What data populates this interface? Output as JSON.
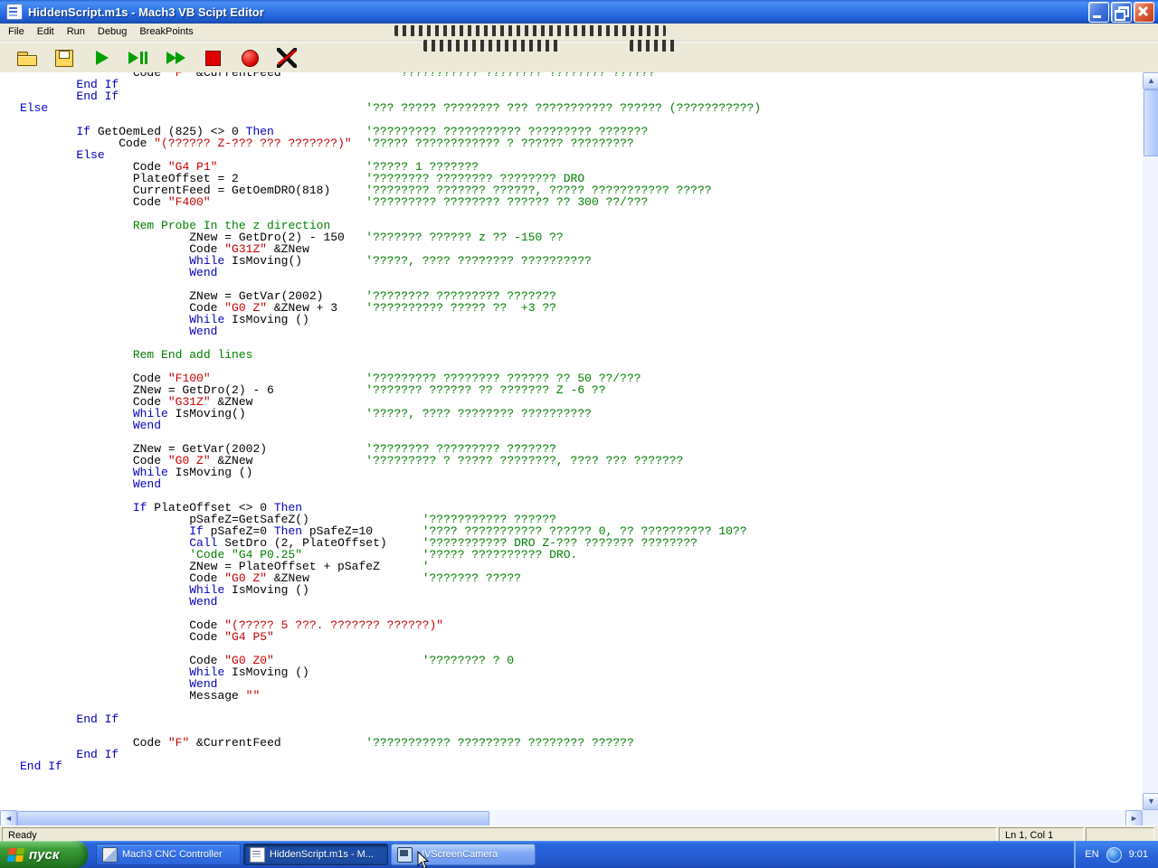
{
  "window": {
    "title": "HiddenScript.m1s - Mach3 VB Scipt Editor"
  },
  "menu": {
    "items": [
      "File",
      "Edit",
      "Run",
      "Debug",
      "BreakPoints"
    ]
  },
  "toolbar": {
    "buttons": [
      {
        "id": "open"
      },
      {
        "id": "save"
      },
      {
        "id": "run"
      },
      {
        "id": "step"
      },
      {
        "id": "fast-forward"
      },
      {
        "id": "stop"
      },
      {
        "id": "breakpoint"
      },
      {
        "id": "clear-breakpoints"
      }
    ]
  },
  "scrollbar": {
    "up": "▲",
    "down": "▼",
    "left": "◄",
    "right": "►"
  },
  "statusbar": {
    "ready": "Ready",
    "position": "Ln 1, Col 1"
  },
  "taskbar": {
    "start_label": "пуск",
    "buttons": [
      {
        "id": "mach3",
        "label": "Mach3 CNC Controller",
        "state": "normal"
      },
      {
        "id": "hiddenscript",
        "label": "HiddenScript.m1s - M...",
        "state": "active"
      },
      {
        "id": "uvscreencamera",
        "label": "UVScreenCamera",
        "state": "highlight"
      }
    ],
    "tray": {
      "language": "EN",
      "time": "9:01"
    }
  },
  "colors": {
    "keyword": "#0000C0",
    "string": "#C80000",
    "comment": "#008000",
    "normal": "#000000"
  },
  "editor": {
    "lines": [
      {
        "i": 16,
        "s": [
          [
            "n",
            "Code "
          ],
          [
            "s",
            "\"F\""
          ],
          [
            "n",
            " &CurrentFeed"
          ]
        ],
        "c": [
          "'??????????? ???????? ???????? ??????",
          53
        ]
      },
      {
        "i": 8,
        "s": [
          [
            "k",
            "End If"
          ]
        ]
      },
      {
        "i": 8,
        "s": [
          [
            "k",
            "End If"
          ]
        ]
      },
      {
        "i": 0,
        "s": [
          [
            "k",
            "Else"
          ]
        ],
        "c": [
          "'??? ????? ???????? ??? ??????????? ?????? (???????????)",
          49
        ]
      },
      null,
      {
        "i": 8,
        "s": [
          [
            "k",
            "If "
          ],
          [
            "n",
            "GetOemLed (825) <> 0 "
          ],
          [
            "k",
            "Then"
          ]
        ],
        "c": [
          "'????????? ??????????? ????????? ???????",
          49
        ]
      },
      {
        "i": 14,
        "s": [
          [
            "n",
            "Code "
          ],
          [
            "s",
            "\"(?????? Z-??? ??? ???????)\""
          ]
        ],
        "c": [
          "'????? ???????????? ? ?????? ?????????",
          49
        ]
      },
      {
        "i": 8,
        "s": [
          [
            "k",
            "Else"
          ]
        ]
      },
      {
        "i": 16,
        "s": [
          [
            "n",
            "Code "
          ],
          [
            "s",
            "\"G4 P1\""
          ]
        ],
        "c": [
          "'????? 1 ???????",
          49
        ]
      },
      {
        "i": 16,
        "s": [
          [
            "n",
            "PlateOffset = 2"
          ]
        ],
        "c": [
          "'???????? ???????? ???????? DRO",
          49
        ]
      },
      {
        "i": 16,
        "s": [
          [
            "n",
            "CurrentFeed = GetOemDRO(818)"
          ]
        ],
        "c": [
          "'???????? ??????? ??????, ????? ??????????? ?????",
          49
        ]
      },
      {
        "i": 16,
        "s": [
          [
            "n",
            "Code "
          ],
          [
            "s",
            "\"F400\""
          ]
        ],
        "c": [
          "'????????? ???????? ?????? ?? 300 ??/???",
          49
        ]
      },
      null,
      {
        "i": 16,
        "s": [
          [
            "c",
            "Rem Probe In the z direction"
          ]
        ]
      },
      {
        "i": 24,
        "s": [
          [
            "n",
            "ZNew = GetDro(2) - 150"
          ]
        ],
        "c": [
          "'??????? ?????? z ?? -150 ??",
          49
        ]
      },
      {
        "i": 24,
        "s": [
          [
            "n",
            "Code "
          ],
          [
            "s",
            "\"G31Z\""
          ],
          [
            "n",
            " &ZNew"
          ]
        ]
      },
      {
        "i": 24,
        "s": [
          [
            "k",
            "While "
          ],
          [
            "n",
            "IsMoving()"
          ]
        ],
        "c": [
          "'?????, ???? ???????? ??????????",
          49
        ]
      },
      {
        "i": 24,
        "s": [
          [
            "k",
            "Wend"
          ]
        ]
      },
      null,
      {
        "i": 24,
        "s": [
          [
            "n",
            "ZNew = GetVar(2002)"
          ]
        ],
        "c": [
          "'???????? ????????? ???????",
          49
        ]
      },
      {
        "i": 24,
        "s": [
          [
            "n",
            "Code "
          ],
          [
            "s",
            "\"G0 Z\""
          ],
          [
            "n",
            " &ZNew + 3"
          ]
        ],
        "c": [
          "'?????????? ????? ??  +3 ??",
          49
        ]
      },
      {
        "i": 24,
        "s": [
          [
            "k",
            "While "
          ],
          [
            "n",
            "IsMoving ()"
          ]
        ]
      },
      {
        "i": 24,
        "s": [
          [
            "k",
            "Wend"
          ]
        ]
      },
      null,
      {
        "i": 16,
        "s": [
          [
            "c",
            "Rem End add lines"
          ]
        ]
      },
      null,
      {
        "i": 16,
        "s": [
          [
            "n",
            "Code "
          ],
          [
            "s",
            "\"F100\""
          ]
        ],
        "c": [
          "'????????? ???????? ?????? ?? 50 ??/???",
          49
        ]
      },
      {
        "i": 16,
        "s": [
          [
            "n",
            "ZNew = GetDro(2) - 6"
          ]
        ],
        "c": [
          "'??????? ?????? ?? ??????? Z -6 ??",
          49
        ]
      },
      {
        "i": 16,
        "s": [
          [
            "n",
            "Code "
          ],
          [
            "s",
            "\"G31Z\""
          ],
          [
            "n",
            " &ZNew"
          ]
        ]
      },
      {
        "i": 16,
        "s": [
          [
            "k",
            "While "
          ],
          [
            "n",
            "IsMoving()"
          ]
        ],
        "c": [
          "'?????, ???? ???????? ??????????",
          49
        ]
      },
      {
        "i": 16,
        "s": [
          [
            "k",
            "Wend"
          ]
        ]
      },
      null,
      {
        "i": 16,
        "s": [
          [
            "n",
            "ZNew = GetVar(2002)"
          ]
        ],
        "c": [
          "'???????? ????????? ???????",
          49
        ]
      },
      {
        "i": 16,
        "s": [
          [
            "n",
            "Code "
          ],
          [
            "s",
            "\"G0 Z\""
          ],
          [
            "n",
            " &ZNew"
          ]
        ],
        "c": [
          "'????????? ? ????? ????????, ???? ??? ???????",
          49
        ]
      },
      {
        "i": 16,
        "s": [
          [
            "k",
            "While "
          ],
          [
            "n",
            "IsMoving ()"
          ]
        ]
      },
      {
        "i": 16,
        "s": [
          [
            "k",
            "Wend"
          ]
        ]
      },
      null,
      {
        "i": 16,
        "s": [
          [
            "k",
            "If "
          ],
          [
            "n",
            "PlateOffset <> 0 "
          ],
          [
            "k",
            "Then"
          ]
        ]
      },
      {
        "i": 24,
        "s": [
          [
            "n",
            "pSafeZ=GetSafeZ()"
          ]
        ],
        "c": [
          "'??????????? ??????",
          57
        ]
      },
      {
        "i": 24,
        "s": [
          [
            "k",
            "If "
          ],
          [
            "n",
            "pSafeZ=0 "
          ],
          [
            "k",
            "Then "
          ],
          [
            "n",
            "pSafeZ=10"
          ]
        ],
        "c": [
          "'???? ??????????? ?????? 0, ?? ?????????? 10??",
          57
        ]
      },
      {
        "i": 24,
        "s": [
          [
            "k",
            "Call "
          ],
          [
            "n",
            "SetDro (2, PlateOffset)"
          ]
        ],
        "c": [
          "'??????????? DRO Z-??? ??????? ????????",
          57
        ]
      },
      {
        "i": 24,
        "s": [
          [
            "c",
            "'Code \"G4 P0.25\""
          ]
        ],
        "c": [
          "'????? ?????????? DRO.",
          57
        ]
      },
      {
        "i": 24,
        "s": [
          [
            "n",
            "ZNew = PlateOffset + pSafeZ"
          ]
        ],
        "c": [
          "'",
          57
        ]
      },
      {
        "i": 24,
        "s": [
          [
            "n",
            "Code "
          ],
          [
            "s",
            "\"G0 Z\""
          ],
          [
            "n",
            " &ZNew"
          ]
        ],
        "c": [
          "'??????? ?????",
          57
        ]
      },
      {
        "i": 24,
        "s": [
          [
            "k",
            "While "
          ],
          [
            "n",
            "IsMoving ()"
          ]
        ]
      },
      {
        "i": 24,
        "s": [
          [
            "k",
            "Wend"
          ]
        ]
      },
      null,
      {
        "i": 24,
        "s": [
          [
            "n",
            "Code "
          ],
          [
            "s",
            "\"(????? 5 ???. ??????? ??????)\""
          ]
        ]
      },
      {
        "i": 24,
        "s": [
          [
            "n",
            "Code "
          ],
          [
            "s",
            "\"G4 P5\""
          ]
        ]
      },
      null,
      {
        "i": 24,
        "s": [
          [
            "n",
            "Code "
          ],
          [
            "s",
            "\"G0 Z0\""
          ]
        ],
        "c": [
          "'???????? ? 0",
          57
        ]
      },
      {
        "i": 24,
        "s": [
          [
            "k",
            "While "
          ],
          [
            "n",
            "IsMoving ()"
          ]
        ]
      },
      {
        "i": 24,
        "s": [
          [
            "k",
            "Wend"
          ]
        ]
      },
      {
        "i": 24,
        "s": [
          [
            "n",
            "Message "
          ],
          [
            "s",
            "\"\""
          ]
        ]
      },
      null,
      {
        "i": 8,
        "s": [
          [
            "k",
            "End If"
          ]
        ]
      },
      null,
      {
        "i": 16,
        "s": [
          [
            "n",
            "Code "
          ],
          [
            "s",
            "\"F\""
          ],
          [
            "n",
            " &CurrentFeed"
          ]
        ],
        "c": [
          "'??????????? ????????? ???????? ??????",
          49
        ]
      },
      {
        "i": 8,
        "s": [
          [
            "k",
            "End If"
          ]
        ]
      },
      {
        "i": 0,
        "s": [
          [
            "k",
            "End If"
          ]
        ]
      }
    ]
  }
}
